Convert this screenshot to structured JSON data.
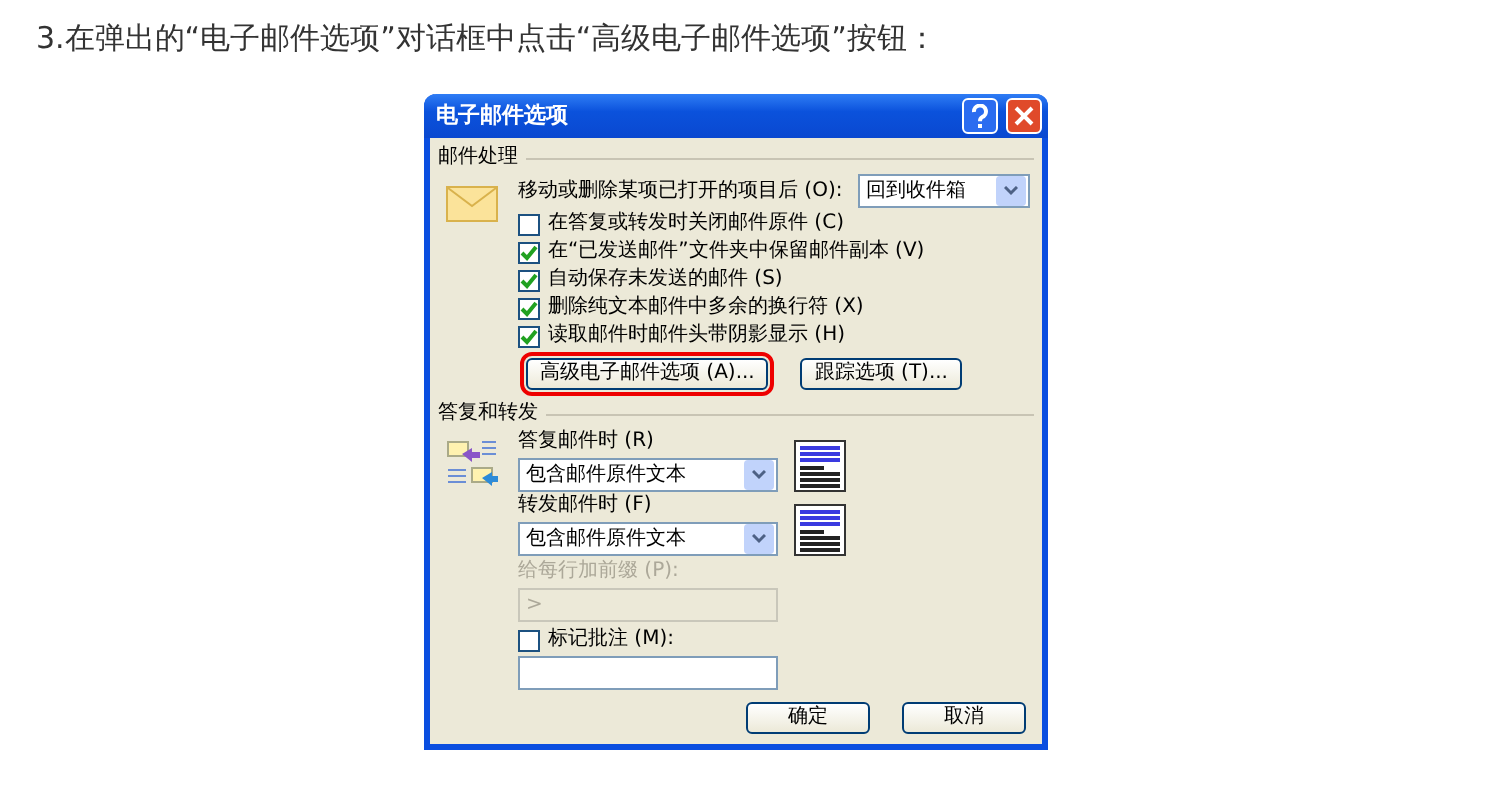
{
  "intro": "3.在弹出的“电子邮件选项”对话框中点击“高级电子邮件选项”按钮：",
  "dialog": {
    "title": "电子邮件选项",
    "message_handling": {
      "heading": "邮件处理",
      "move_label": "移动或删除某项已打开的项目后 (O):",
      "move_value": "回到收件箱",
      "options": [
        {
          "label": "在答复或转发时关闭邮件原件 (C)",
          "checked": false
        },
        {
          "label": "在“已发送邮件”文件夹中保留邮件副本 (V)",
          "checked": true
        },
        {
          "label": "自动保存未发送的邮件 (S)",
          "checked": true
        },
        {
          "label": "删除纯文本邮件中多余的换行符 (X)",
          "checked": true
        },
        {
          "label": "读取邮件时邮件头带阴影显示 (H)",
          "checked": true
        }
      ],
      "buttons": [
        {
          "label": "高级电子邮件选项 (A)...",
          "highlighted": true
        },
        {
          "label": "跟踪选项 (T)...",
          "highlighted": false
        }
      ]
    },
    "replies": {
      "heading": "答复和转发",
      "fields": [
        {
          "label": "答复邮件时 (R)",
          "value": "包含邮件原件文本"
        },
        {
          "label": "转发邮件时 (F)",
          "value": "包含邮件原件文本"
        }
      ],
      "prefix": {
        "label": "给每行加前缀 (P):",
        "value": ">",
        "disabled": true
      },
      "mark": {
        "label": "标记批注 (M):",
        "checked": false
      }
    },
    "footer_buttons": [
      "确定",
      "取消"
    ]
  }
}
